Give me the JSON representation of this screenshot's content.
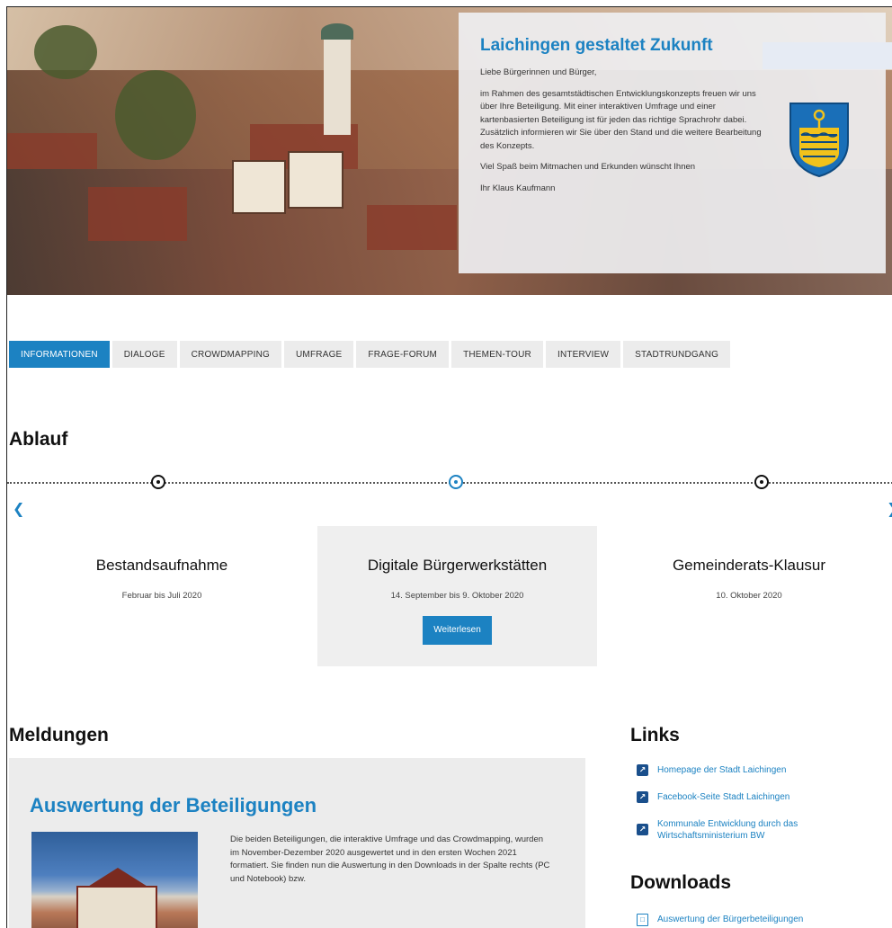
{
  "intro": {
    "title": "Laichingen gestaltet Zukunft",
    "greeting": "Liebe Bürgerinnen und Bürger,",
    "body": "im Rahmen des gesamtstädtischen Entwicklungskonzepts freuen wir uns über Ihre Beteiligung. Mit einer interaktiven Umfrage und einer kartenbasierten Beteiligung ist für jeden das richtige Sprachrohr dabei. Zusätzlich informieren wir Sie über den Stand und die weitere Bearbeitung des Konzepts.",
    "wish": "Viel Spaß beim Mitmachen und Erkunden wünscht Ihnen",
    "signature": "Ihr Klaus Kaufmann"
  },
  "tabs": [
    "INFORMATIONEN",
    "DIALOGE",
    "CROWDMAPPING",
    "UMFRAGE",
    "FRAGE-FORUM",
    "THEMEN-TOUR",
    "INTERVIEW",
    "STADTRUNDGANG"
  ],
  "ablauf": {
    "heading": "Ablauf",
    "phases": [
      {
        "title": "Bestandsaufnahme",
        "date": "Februar bis Juli 2020"
      },
      {
        "title": "Digitale Bürgerwerkstätten",
        "date": "14. September bis 9. Oktober 2020",
        "button": "Weiterlesen"
      },
      {
        "title": "Gemeinderats-Klausur",
        "date": "10. Oktober 2020"
      }
    ]
  },
  "meldungen": {
    "heading": "Meldungen",
    "title": "Auswertung der Beteiligungen",
    "text": "Die beiden Beteiligungen, die interaktive Umfrage und das Crowdmapping, wurden im November-Dezember 2020 ausgewertet und in den ersten Wochen 2021 formatiert. Sie finden nun die Auswertung in den Downloads in der Spalte rechts (PC und Notebook) bzw."
  },
  "links": {
    "heading": "Links",
    "items": [
      "Homepage der Stadt Laichingen",
      "Facebook-Seite Stadt Laichingen",
      "Kommunale Entwicklung durch das Wirtschaftsministerium BW"
    ]
  },
  "downloads": {
    "heading": "Downloads",
    "items": [
      "Auswertung der Bürgerbeteiligungen"
    ]
  },
  "colors": {
    "accent": "#1c82c2",
    "panel": "#ececec"
  },
  "icons": {
    "link": "external-link-icon",
    "download": "pdf-file-icon",
    "prev": "chevron-left-icon",
    "next": "chevron-right-icon"
  }
}
